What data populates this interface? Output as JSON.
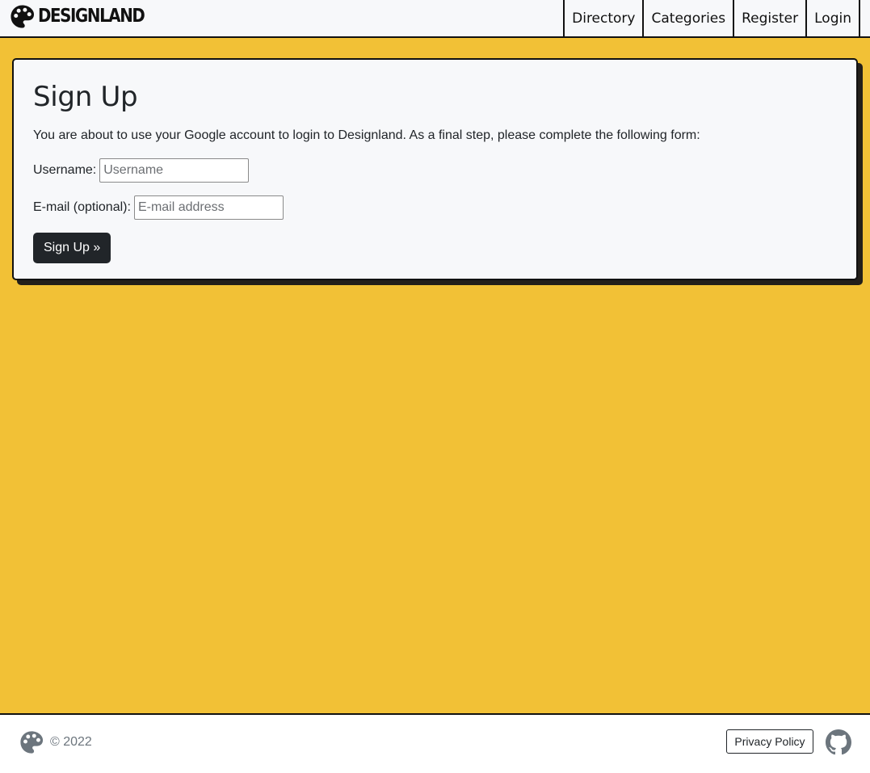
{
  "header": {
    "brand": "DESIGNLAND",
    "nav": [
      "Directory",
      "Categories",
      "Register",
      "Login"
    ]
  },
  "form": {
    "title": "Sign Up",
    "intro": "You are about to use your Google account to login to Designland. As a final step, please complete the following form:",
    "username_label": "Username:",
    "username_placeholder": "Username",
    "email_label": "E-mail (optional):",
    "email_placeholder": "E-mail address",
    "submit_label": "Sign Up »"
  },
  "footer": {
    "copyright": "© 2022",
    "privacy_label": "Privacy Policy"
  },
  "icons": {
    "brand_icon": "palette-icon",
    "footer_icon": "palette-icon",
    "github_icon": "github-icon"
  },
  "colors": {
    "page_background": "#f2c136",
    "card_background": "#f7f8fa",
    "button_background": "#212529",
    "border": "#111111"
  }
}
